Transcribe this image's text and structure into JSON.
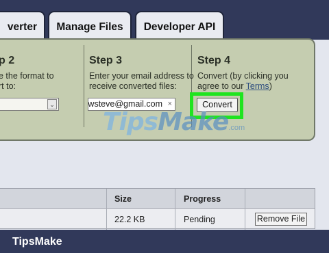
{
  "tabs": [
    "verter",
    "Manage Files",
    "Developer API"
  ],
  "steps": [
    {
      "title": "p 2",
      "text_lines": [
        "e the format to",
        "rt to:"
      ]
    },
    {
      "title": "Step 3",
      "text_lines": [
        "Enter your email address to",
        "receive converted files:"
      ]
    },
    {
      "title": "Step 4",
      "text_lines": [
        "Convert (by clicking you",
        "agree to our "
      ],
      "link": "Terms",
      "after_link": ")"
    }
  ],
  "format_select": {
    "caret": "⌄"
  },
  "email_field": {
    "value": "howsteve@gmail.com",
    "clear": "×"
  },
  "convert_button": "Convert",
  "watermark": {
    "part1": "Tips",
    "part2": "Make",
    "suffix": ".com"
  },
  "files_table": {
    "headers": [
      "Size",
      "Progress"
    ],
    "row": {
      "size": "22.2 KB",
      "progress": "Pending",
      "action": "Remove File"
    }
  },
  "brand": "TipsMake",
  "colors": {
    "highlight": "#1fe41f",
    "panel": "#c5cdb0",
    "header_band": "#31395a"
  }
}
